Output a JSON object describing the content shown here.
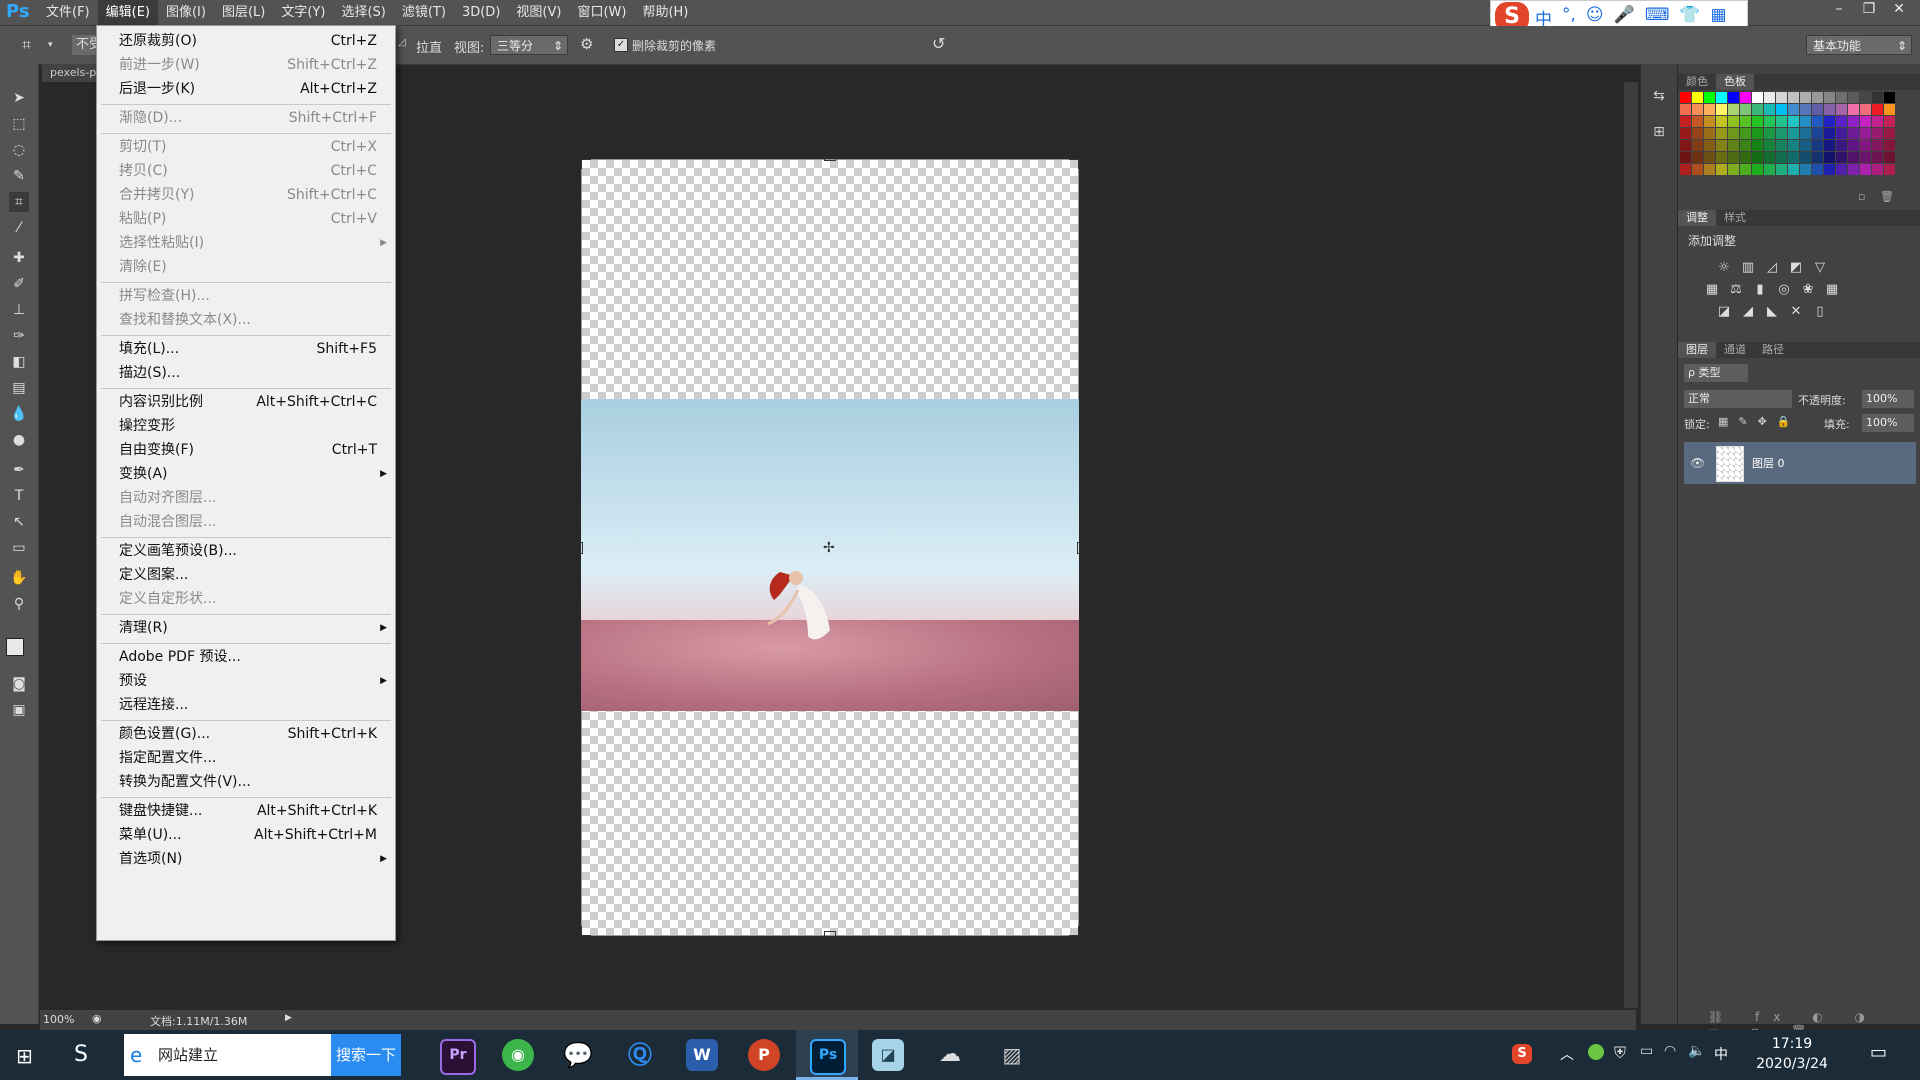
{
  "app": {
    "logo": "Ps"
  },
  "menubar": {
    "items": [
      "文件(F)",
      "编辑(E)",
      "图像(I)",
      "图层(L)",
      "文字(Y)",
      "选择(S)",
      "滤镜(T)",
      "3D(D)",
      "视图(V)",
      "窗口(W)",
      "帮助(H)"
    ],
    "active_index": 1
  },
  "ime": {
    "logo": "S",
    "items": [
      "中",
      "°,",
      "☺",
      "🎤",
      "⌨",
      "👕",
      "▦"
    ]
  },
  "options_bar": {
    "not_label": "不受",
    "straighten": "拉直",
    "view_label": "视图:",
    "view_value": "三等分",
    "delete_cropped": "删除裁剪的像素",
    "workspace": "基本功能"
  },
  "document": {
    "tab_name": "pexels-p"
  },
  "status": {
    "zoom": "100%",
    "doc_info": "文档:1.11M/1.36M"
  },
  "panels": {
    "color_tabs": [
      "颜色",
      "色板"
    ],
    "adjust_tabs": [
      "调整",
      "样式"
    ],
    "add_adjustment": "添加调整",
    "layer_tabs": [
      "图层",
      "通道",
      "路径"
    ],
    "layer_filter": "ρ 类型",
    "blend_mode": "正常",
    "opacity_label": "不透明度:",
    "opacity_value": "100%",
    "lock_label": "锁定:",
    "fill_label": "填充:",
    "fill_value": "100%",
    "layer_name": "图层 0"
  },
  "edit_menu": [
    {
      "label": "还原裁剪(O)",
      "shortcut": "Ctrl+Z",
      "disabled": false
    },
    {
      "label": "前进一步(W)",
      "shortcut": "Shift+Ctrl+Z",
      "disabled": true
    },
    {
      "label": "后退一步(K)",
      "shortcut": "Alt+Ctrl+Z",
      "disabled": false
    },
    {
      "sep": true
    },
    {
      "label": "渐隐(D)...",
      "shortcut": "Shift+Ctrl+F",
      "disabled": true
    },
    {
      "sep": true
    },
    {
      "label": "剪切(T)",
      "shortcut": "Ctrl+X",
      "disabled": true
    },
    {
      "label": "拷贝(C)",
      "shortcut": "Ctrl+C",
      "disabled": true
    },
    {
      "label": "合并拷贝(Y)",
      "shortcut": "Shift+Ctrl+C",
      "disabled": true
    },
    {
      "label": "粘贴(P)",
      "shortcut": "Ctrl+V",
      "disabled": true
    },
    {
      "label": "选择性粘贴(I)",
      "shortcut": "",
      "disabled": true,
      "submenu": true
    },
    {
      "label": "清除(E)",
      "shortcut": "",
      "disabled": true
    },
    {
      "sep": true
    },
    {
      "label": "拼写检查(H)...",
      "shortcut": "",
      "disabled": true
    },
    {
      "label": "查找和替换文本(X)...",
      "shortcut": "",
      "disabled": true
    },
    {
      "sep": true
    },
    {
      "label": "填充(L)...",
      "shortcut": "Shift+F5",
      "disabled": false
    },
    {
      "label": "描边(S)...",
      "shortcut": "",
      "disabled": false
    },
    {
      "sep": true
    },
    {
      "label": "内容识别比例",
      "shortcut": "Alt+Shift+Ctrl+C",
      "disabled": false
    },
    {
      "label": "操控变形",
      "shortcut": "",
      "disabled": false
    },
    {
      "label": "自由变换(F)",
      "shortcut": "Ctrl+T",
      "disabled": false
    },
    {
      "label": "变换(A)",
      "shortcut": "",
      "disabled": false,
      "submenu": true
    },
    {
      "label": "自动对齐图层...",
      "shortcut": "",
      "disabled": true
    },
    {
      "label": "自动混合图层...",
      "shortcut": "",
      "disabled": true
    },
    {
      "sep": true
    },
    {
      "label": "定义画笔预设(B)...",
      "shortcut": "",
      "disabled": false
    },
    {
      "label": "定义图案...",
      "shortcut": "",
      "disabled": false
    },
    {
      "label": "定义自定形状...",
      "shortcut": "",
      "disabled": true
    },
    {
      "sep": true
    },
    {
      "label": "清理(R)",
      "shortcut": "",
      "disabled": false,
      "submenu": true
    },
    {
      "sep": true
    },
    {
      "label": "Adobe PDF 预设...",
      "shortcut": "",
      "disabled": false
    },
    {
      "label": "预设",
      "shortcut": "",
      "disabled": false,
      "submenu": true
    },
    {
      "label": "远程连接...",
      "shortcut": "",
      "disabled": false
    },
    {
      "sep": true
    },
    {
      "label": "颜色设置(G)...",
      "shortcut": "Shift+Ctrl+K",
      "disabled": false
    },
    {
      "label": "指定配置文件...",
      "shortcut": "",
      "disabled": false
    },
    {
      "label": "转换为配置文件(V)...",
      "shortcut": "",
      "disabled": false
    },
    {
      "sep": true
    },
    {
      "label": "键盘快捷键...",
      "shortcut": "Alt+Shift+Ctrl+K",
      "disabled": false
    },
    {
      "label": "菜单(U)...",
      "shortcut": "Alt+Shift+Ctrl+M",
      "disabled": false
    },
    {
      "label": "首选项(N)",
      "shortcut": "",
      "disabled": false,
      "submenu": true
    }
  ],
  "taskbar": {
    "search_text": "网站建立",
    "search_button": "搜索一下",
    "apps": [
      "Pr",
      "Ps"
    ],
    "ime_indicator": "中",
    "time": "17:19",
    "date": "2020/3/24"
  },
  "colors": {
    "ps_blue": "#31a8ff",
    "layer_highlight": "#596a80",
    "taskbar": "#1c2b38"
  }
}
